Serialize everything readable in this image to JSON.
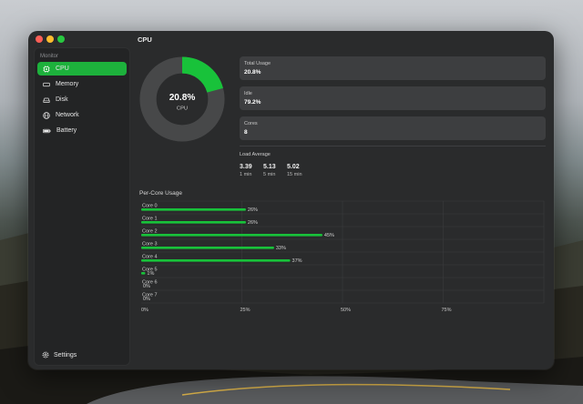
{
  "window": {
    "title": "CPU"
  },
  "sidebar": {
    "section": "Monitor",
    "items": [
      {
        "label": "CPU",
        "icon": "cpu-icon",
        "active": true
      },
      {
        "label": "Memory",
        "icon": "memory-icon",
        "active": false
      },
      {
        "label": "Disk",
        "icon": "disk-icon",
        "active": false
      },
      {
        "label": "Network",
        "icon": "globe-icon",
        "active": false
      },
      {
        "label": "Battery",
        "icon": "battery-icon",
        "active": false
      }
    ],
    "settings_label": "Settings"
  },
  "gauge": {
    "value_text": "20.8%",
    "label": "CPU",
    "fraction": 0.208,
    "color": "#18c23a"
  },
  "stats": [
    {
      "label": "Total Usage",
      "value": "20.8%"
    },
    {
      "label": "Idle",
      "value": "79.2%"
    },
    {
      "label": "Cores",
      "value": "8"
    }
  ],
  "load": {
    "title": "Load Average",
    "items": [
      {
        "value": "3.39",
        "label": "1 min"
      },
      {
        "value": "5.13",
        "label": "5 min"
      },
      {
        "value": "5.02",
        "label": "15 min"
      }
    ]
  },
  "per_core": {
    "title": "Per-Core Usage",
    "axis_ticks": [
      "0%",
      "25%",
      "50%",
      "75%"
    ],
    "cores": [
      {
        "name": "Core 0",
        "value": 26,
        "text": "26%"
      },
      {
        "name": "Core 1",
        "value": 26,
        "text": "26%"
      },
      {
        "name": "Core 2",
        "value": 45,
        "text": "45%"
      },
      {
        "name": "Core 3",
        "value": 33,
        "text": "33%"
      },
      {
        "name": "Core 4",
        "value": 37,
        "text": "37%"
      },
      {
        "name": "Core 5",
        "value": 1,
        "text": "1%"
      },
      {
        "name": "Core 6",
        "value": 0,
        "text": "0%"
      },
      {
        "name": "Core 7",
        "value": 0,
        "text": "0%"
      }
    ]
  },
  "colors": {
    "accent": "#1db13c",
    "bar": "#18c23a"
  }
}
